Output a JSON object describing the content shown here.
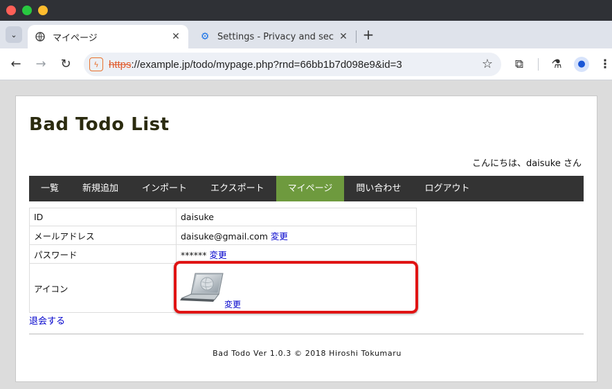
{
  "browser": {
    "tabs": [
      {
        "title": "マイページ",
        "icon": "globe-icon",
        "close": "✕"
      },
      {
        "title": "Settings - Privacy and sec",
        "icon": "gear-icon",
        "close": "✕"
      }
    ],
    "new_tab": "+",
    "url_scheme": "https",
    "url_rest": "://example.jp/todo/mypage.php?rnd=66bb1b7d098e9&id=3"
  },
  "page": {
    "site_title": "Bad Todo List",
    "greeting": "こんにちは、daisuke さん",
    "nav": [
      "一覧",
      "新規追加",
      "インポート",
      "エクスポート",
      "マイページ",
      "問い合わせ",
      "ログアウト"
    ],
    "current_nav": "マイページ",
    "profile": {
      "id_label": "ID",
      "id_value": "daisuke",
      "email_label": "メールアドレス",
      "email_value": "daisuke@gmail.com",
      "email_change": "変更",
      "password_label": "パスワード",
      "password_value": "******",
      "password_change": "変更",
      "icon_label": "アイコン",
      "icon_change": "変更"
    },
    "withdraw": "退会する",
    "footer": "Bad Todo Ver 1.0.3 © 2018 Hiroshi Tokumaru"
  },
  "colors": {
    "nav_bg": "#333333",
    "nav_active": "#6e9a3e",
    "link": "#0000cc",
    "highlight": "#e01414"
  }
}
